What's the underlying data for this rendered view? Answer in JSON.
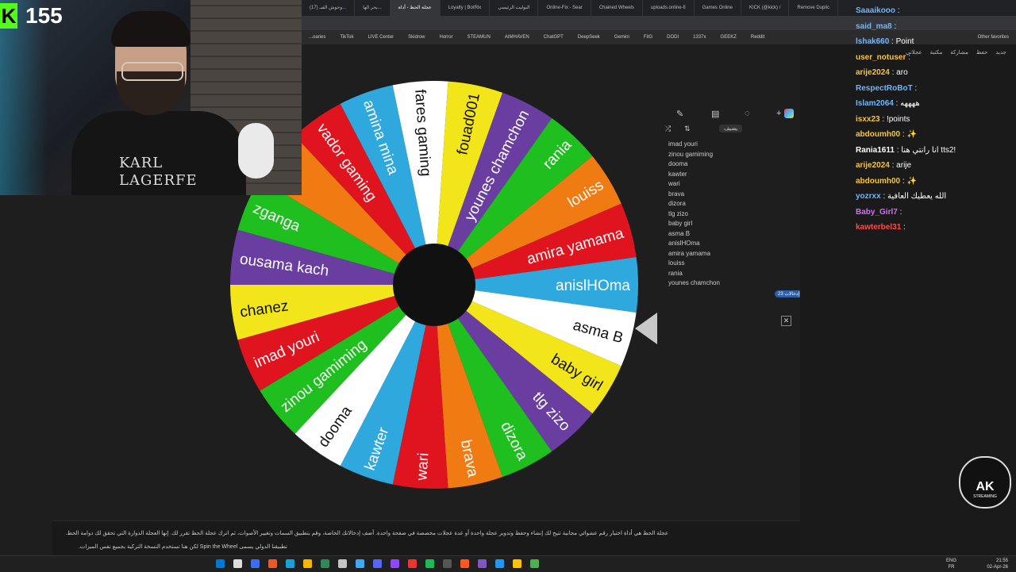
{
  "browser": {
    "tabs": [
      "(17) وحوش القبـ...",
      "بحر الها...",
      "عجلة الحظ - أداة",
      "Loyalty | BotRix",
      "البوليت الرئيسي",
      "Online-Fix - Sear",
      "Chained Wheels",
      "uploads.online-fi",
      "Games Online",
      "KICK (@kick) /",
      "Remove Duplic"
    ],
    "bookmarks": [
      "...oaries",
      "TikTok",
      "LIVE Center",
      "Skidrow",
      "Horror",
      "STEAMUN",
      "AIMHAVEN",
      "ChatGPT",
      "DeepSeek",
      "Gemini",
      "FitG",
      "DODI",
      "1337x",
      "GEEKZ",
      "Reddit"
    ],
    "other_favorites": "Other favorites"
  },
  "stream": {
    "viewer_count": "155",
    "shirt_line1": "KARL",
    "shirt_line2": "LAGERFE"
  },
  "wheel": {
    "segments": [
      {
        "label": "anislHOma",
        "color": "#2ea8dd"
      },
      {
        "label": "asma B",
        "color": "#ffffff"
      },
      {
        "label": "baby girl",
        "color": "#f2e51a"
      },
      {
        "label": "tlg zizo",
        "color": "#6a3ea1"
      },
      {
        "label": "dizora",
        "color": "#1fbf1f"
      },
      {
        "label": "brava",
        "color": "#f07b12"
      },
      {
        "label": "wari",
        "color": "#e0141e"
      },
      {
        "label": "kawter",
        "color": "#2ea8dd"
      },
      {
        "label": "dooma",
        "color": "#ffffff"
      },
      {
        "label": "zinou gamiming",
        "color": "#1fbf1f"
      },
      {
        "label": "imad youri",
        "color": "#e0141e"
      },
      {
        "label": "chanez",
        "color": "#f2e51a"
      },
      {
        "label": "ousama kach",
        "color": "#6a3ea1"
      },
      {
        "label": "zganga",
        "color": "#1fbf1f"
      },
      {
        "label": "",
        "color": "#f07b12"
      },
      {
        "label": "vador gaming",
        "color": "#e0141e"
      },
      {
        "label": "amina mina",
        "color": "#2ea8dd"
      },
      {
        "label": "fares gaming",
        "color": "#ffffff"
      },
      {
        "label": "fouad001",
        "color": "#f2e51a"
      },
      {
        "label": "younes chamchon",
        "color": "#6a3ea1"
      },
      {
        "label": "rania",
        "color": "#1fbf1f"
      },
      {
        "label": "louiss",
        "color": "#f07b12"
      },
      {
        "label": "amira yamama",
        "color": "#e0141e"
      }
    ]
  },
  "panel": {
    "shuffle_label": "يضيف",
    "entries": [
      "imad youri",
      "zinou gamiming",
      "dooma",
      "kawter",
      "wari",
      "brava",
      "dizora",
      "tlg zizo",
      "baby girl",
      "asma B",
      "anislHOma",
      "amira yamama",
      "louiss",
      "rania",
      "younes chamchon"
    ],
    "count_badge": "23 إدخالات"
  },
  "chat": {
    "topbar": [
      "عجلاتي",
      "مكتبة",
      "مشاركة",
      "حفظ",
      "جديد"
    ],
    "messages": [
      {
        "user": "Saaaikooo",
        "text": "",
        "color": "#6fb6ff"
      },
      {
        "user": "said_ma8",
        "text": "",
        "color": "#6fb6ff"
      },
      {
        "user": "lshak660",
        "text": "Point",
        "color": "#6fb6ff"
      },
      {
        "user": "user_notuser",
        "text": "",
        "color": "#f5c542"
      },
      {
        "user": "arije2024",
        "text": "aro",
        "color": "#f5c542"
      },
      {
        "user": "RespectRoBoT",
        "text": "",
        "color": "#6fb6ff"
      },
      {
        "user": "Islam2064",
        "text": "ههههه",
        "color": "#6fb6ff"
      },
      {
        "user": "isxx23",
        "text": "!points",
        "color": "#f5c542"
      },
      {
        "user": "abdoumh00",
        "text": "✨",
        "color": "#f5c542"
      },
      {
        "user": "Rania1611",
        "text": "انا رانتي هنا tts2!",
        "color": "#ffffff"
      },
      {
        "user": "arije2024",
        "text": "arije",
        "color": "#f5c542"
      },
      {
        "user": "abdoumh00",
        "text": "✨",
        "color": "#f5c542"
      },
      {
        "user": "yozrxx",
        "text": "الله يعطيك العافية",
        "color": "#6fb6ff"
      },
      {
        "user": "Baby_Girl7",
        "text": "",
        "color": "#d66bff"
      },
      {
        "user": "kawterbel31",
        "text": "",
        "color": "#ff4b4b"
      }
    ]
  },
  "description": {
    "line1": ".عجلة الحظ هي أداة اختيار رقم عشوائي مجانية تتيح لك إنشاء وحفظ وتدوير عجلة واحدة أو عدة عجلات مخصصة في صفحة واحدة. أضف إدخالاتك الخاصة، وقم بتطبيق السمات وتغيير الأصوات، ثم اترك عجلة الحظ تقرر لك. إنها العجلة الدوارة التي تحقق لك دوامة الحظ",
    "line2": ".لكن هنا تستخدم النسخة التركية بجميع نفس الميزات Spin the Wheel تطبيقنا الدولي يسمى"
  },
  "logo": {
    "l1": "AK",
    "l2": "STREAMING"
  },
  "taskbar": {
    "lang1": "ENG",
    "lang2": "FR",
    "time": "21:55",
    "date": "02-Apr-26"
  }
}
